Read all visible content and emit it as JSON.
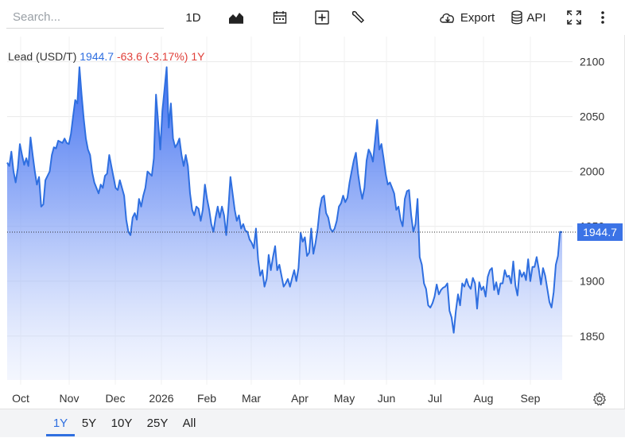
{
  "toolbar": {
    "search_placeholder": "Search...",
    "interval_label": "1D",
    "export_label": "Export",
    "api_label": "API",
    "icons": [
      "chart-type-icon",
      "calendar-icon",
      "plus-icon",
      "wrench-icon",
      "cloud-download-icon",
      "database-icon",
      "fullscreen-icon",
      "more-vert-icon"
    ]
  },
  "legend": {
    "name": "Lead (USD/T)",
    "price": "1944.7",
    "change": "-63.6 (-3.17%)",
    "period": "1Y"
  },
  "range_buttons": [
    "1Y",
    "5Y",
    "10Y",
    "25Y",
    "All"
  ],
  "active_range": "1Y",
  "colors": {
    "line": "#2f6fe0",
    "fill_top": "#4f7ff0",
    "negative": "#e0403a",
    "last_label_bg": "#3b73e6"
  },
  "chart_data": {
    "type": "area",
    "title": "",
    "series": [
      {
        "name": "Lead (USD/T)",
        "values": [
          2008,
          2005,
          2018,
          2000,
          1990,
          2003,
          2025,
          2015,
          2006,
          2012,
          2005,
          2031,
          2015,
          2000,
          1988,
          1995,
          1968,
          1970,
          1992,
          1996,
          2000,
          2015,
          2022,
          2021,
          2028,
          2027,
          2026,
          2030,
          2026,
          2025,
          2034,
          2050,
          2065,
          2062,
          2095,
          2070,
          2048,
          2030,
          2020,
          2015,
          1999,
          1990,
          1985,
          1980,
          1988,
          1985,
          1996,
          1998,
          2015,
          2005,
          1995,
          1985,
          1983,
          1992,
          1985,
          1978,
          1956,
          1945,
          1942,
          1958,
          1962,
          1956,
          1975,
          1968,
          1978,
          1985,
          2000,
          1998,
          1996,
          2012,
          2070,
          2045,
          2020,
          2055,
          2075,
          2095,
          2040,
          2062,
          2030,
          2022,
          2025,
          2030,
          2015,
          2005,
          2015,
          2005,
          1980,
          1965,
          1960,
          1968,
          1966,
          1955,
          1965,
          1988,
          1975,
          1965,
          1952,
          1945,
          1958,
          1968,
          1958,
          1968,
          1960,
          1942,
          1965,
          1995,
          1980,
          1965,
          1955,
          1960,
          1948,
          1952,
          1946,
          1945,
          1938,
          1935,
          1930,
          1948,
          1920,
          1905,
          1910,
          1895,
          1902,
          1924,
          1910,
          1922,
          1932,
          1910,
          1915,
          1905,
          1895,
          1898,
          1902,
          1895,
          1903,
          1910,
          1900,
          1912,
          1944,
          1936,
          1940,
          1923,
          1926,
          1948,
          1925,
          1935,
          1948,
          1966,
          1976,
          1978,
          1962,
          1958,
          1948,
          1945,
          1948,
          1955,
          1968,
          1971,
          1978,
          1972,
          1976,
          1990,
          2000,
          2010,
          2017,
          1998,
          1985,
          1975,
          1985,
          2010,
          2020,
          2016,
          2009,
          2028,
          2047,
          2020,
          2025,
          2012,
          1998,
          1988,
          1990,
          1985,
          1980,
          1965,
          1968,
          1956,
          1950,
          1975,
          1982,
          1983,
          1960,
          1945,
          1952,
          1975,
          1922,
          1915,
          1898,
          1893,
          1878,
          1876,
          1880,
          1886,
          1897,
          1888,
          1892,
          1894,
          1895,
          1898,
          1873,
          1867,
          1853,
          1873,
          1888,
          1878,
          1898,
          1895,
          1902,
          1896,
          1893,
          1903,
          1898,
          1875,
          1899,
          1892,
          1895,
          1886,
          1904,
          1910,
          1912,
          1892,
          1899,
          1888,
          1898,
          1898,
          1910,
          1904,
          1905,
          1898,
          1918,
          1896,
          1887,
          1910,
          1904,
          1908,
          1901,
          1920,
          1900,
          1913,
          1913,
          1922,
          1911,
          1897,
          1912,
          1905,
          1893,
          1881,
          1876,
          1890,
          1915,
          1923,
          1945,
          1944.7
        ]
      }
    ],
    "x_tick_labels": [
      "Oct",
      "Nov",
      "Dec",
      "2026",
      "Feb",
      "Mar",
      "Apr",
      "May",
      "Jun",
      "Jul",
      "Aug",
      "Sep"
    ],
    "y_ticks": [
      1850,
      1900,
      1950,
      2000,
      2050,
      2100
    ],
    "ylim": [
      1810,
      2120
    ],
    "last_value": 1944.7,
    "last_value_label": "1944.7",
    "grid": true,
    "legend_position": "top-left"
  }
}
